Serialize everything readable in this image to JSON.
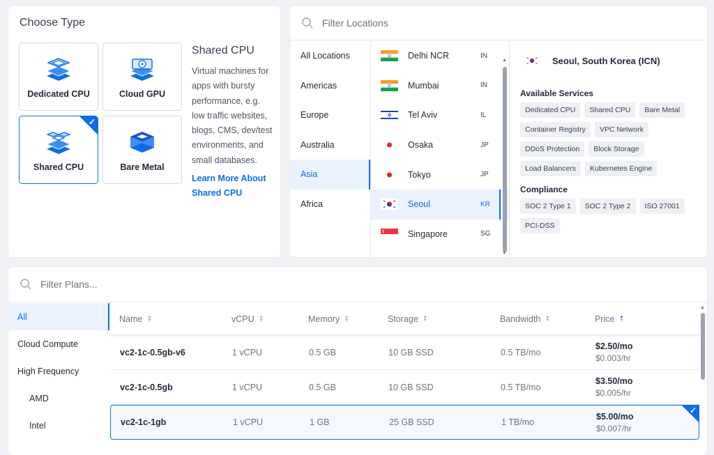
{
  "type_panel": {
    "title": "Choose Type",
    "tiles": [
      {
        "label": "Dedicated CPU",
        "icon": "dedicated-cpu-icon"
      },
      {
        "label": "Cloud GPU",
        "icon": "cloud-gpu-icon"
      },
      {
        "label": "Shared CPU",
        "icon": "shared-cpu-icon",
        "selected": true
      },
      {
        "label": "Bare Metal",
        "icon": "bare-metal-icon"
      }
    ],
    "description": {
      "heading": "Shared CPU",
      "text": "Virtual machines for apps with bursty performance, e.g. low traffic websites, blogs, CMS, dev/test environments, and small databases.",
      "link": "Learn More About Shared CPU"
    }
  },
  "locations": {
    "search_placeholder": "Filter Locations",
    "regions": [
      "All Locations",
      "Americas",
      "Europe",
      "Australia",
      "Asia",
      "Africa"
    ],
    "selected_region": "Asia",
    "cities": [
      {
        "name": "Delhi NCR",
        "code": "IN"
      },
      {
        "name": "Mumbai",
        "code": "IN"
      },
      {
        "name": "Tel Aviv",
        "code": "IL"
      },
      {
        "name": "Osaka",
        "code": "JP"
      },
      {
        "name": "Tokyo",
        "code": "JP"
      },
      {
        "name": "Seoul",
        "code": "KR",
        "selected": true
      },
      {
        "name": "Singapore",
        "code": "SG"
      }
    ],
    "detail": {
      "title": "Seoul, South Korea (ICN)",
      "services_heading": "Available Services",
      "services": [
        "Dedicated CPU",
        "Shared CPU",
        "Bare Metal",
        "Container Registry",
        "VPC Network",
        "DDoS Protection",
        "Block Storage",
        "Load Balancers",
        "Kubernetes Engine"
      ],
      "compliance_heading": "Compliance",
      "compliance": [
        "SOC 2 Type 1",
        "SOC 2 Type 2",
        "ISO 27001",
        "PCI-DSS"
      ]
    }
  },
  "plans": {
    "search_placeholder": "Filter Plans...",
    "categories": [
      {
        "label": "All",
        "selected": true
      },
      {
        "label": "Cloud Compute"
      },
      {
        "label": "High Frequency"
      },
      {
        "label": "AMD",
        "sub": true
      },
      {
        "label": "Intel",
        "sub": true
      }
    ],
    "columns": [
      "Name",
      "vCPU",
      "Memory",
      "Storage",
      "Bandwidth",
      "Price"
    ],
    "sorted_column": "Price",
    "rows": [
      {
        "name": "vc2-1c-0.5gb-v6",
        "vcpu": "1 vCPU",
        "memory": "0.5 GB",
        "storage": "10 GB SSD",
        "bandwidth": "0.5 TB/mo",
        "price_mo": "$2.50/mo",
        "price_hr": "$0.003/hr"
      },
      {
        "name": "vc2-1c-0.5gb",
        "vcpu": "1 vCPU",
        "memory": "0.5 GB",
        "storage": "10 GB SSD",
        "bandwidth": "0.5 TB/mo",
        "price_mo": "$3.50/mo",
        "price_hr": "$0.005/hr"
      },
      {
        "name": "vc2-1c-1gb",
        "vcpu": "1 vCPU",
        "memory": "1 GB",
        "storage": "25 GB SSD",
        "bandwidth": "1 TB/mo",
        "price_mo": "$5.00/mo",
        "price_hr": "$0.007/hr",
        "selected": true
      }
    ]
  },
  "colors": {
    "accent": "#0b6ee8",
    "selected_bg": "#eaf2fd"
  }
}
